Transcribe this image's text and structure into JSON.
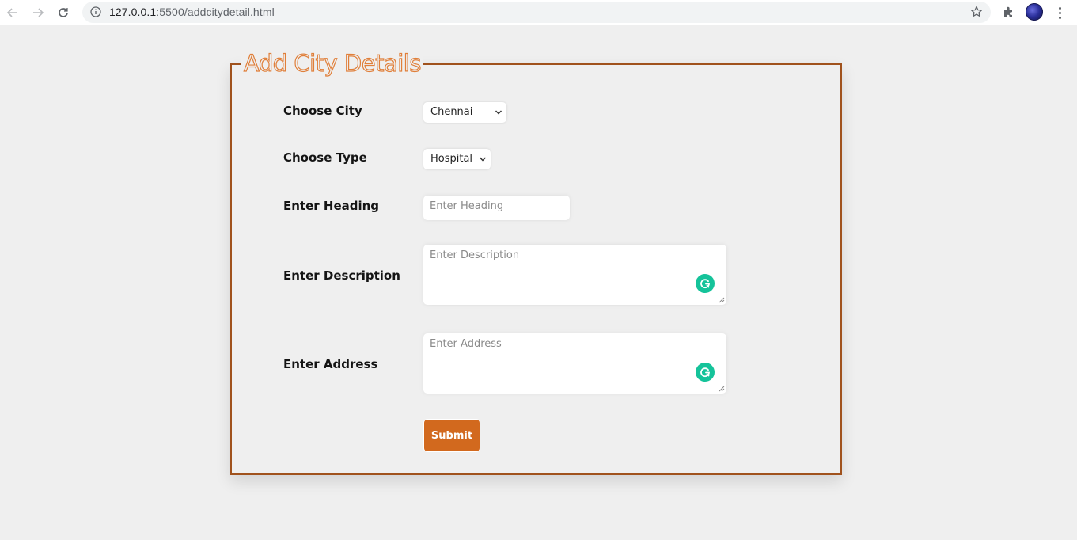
{
  "browser": {
    "url_host": "127.0.0.1",
    "url_path": ":5500/addcitydetail.html"
  },
  "form": {
    "legend": "Add City Details",
    "fields": {
      "city": {
        "label": "Choose City",
        "value": "Chennai"
      },
      "type": {
        "label": "Choose Type",
        "value": "Hospital"
      },
      "heading": {
        "label": "Enter Heading",
        "placeholder": "Enter Heading"
      },
      "description": {
        "label": "Enter Description",
        "placeholder": "Enter Description"
      },
      "address": {
        "label": "Enter Address",
        "placeholder": "Enter Address"
      }
    },
    "submit_label": "Submit"
  },
  "colors": {
    "accent": "#d2691e",
    "border": "#a0521d",
    "legend_outline": "#e07f3a",
    "grammarly": "#15c39a"
  }
}
